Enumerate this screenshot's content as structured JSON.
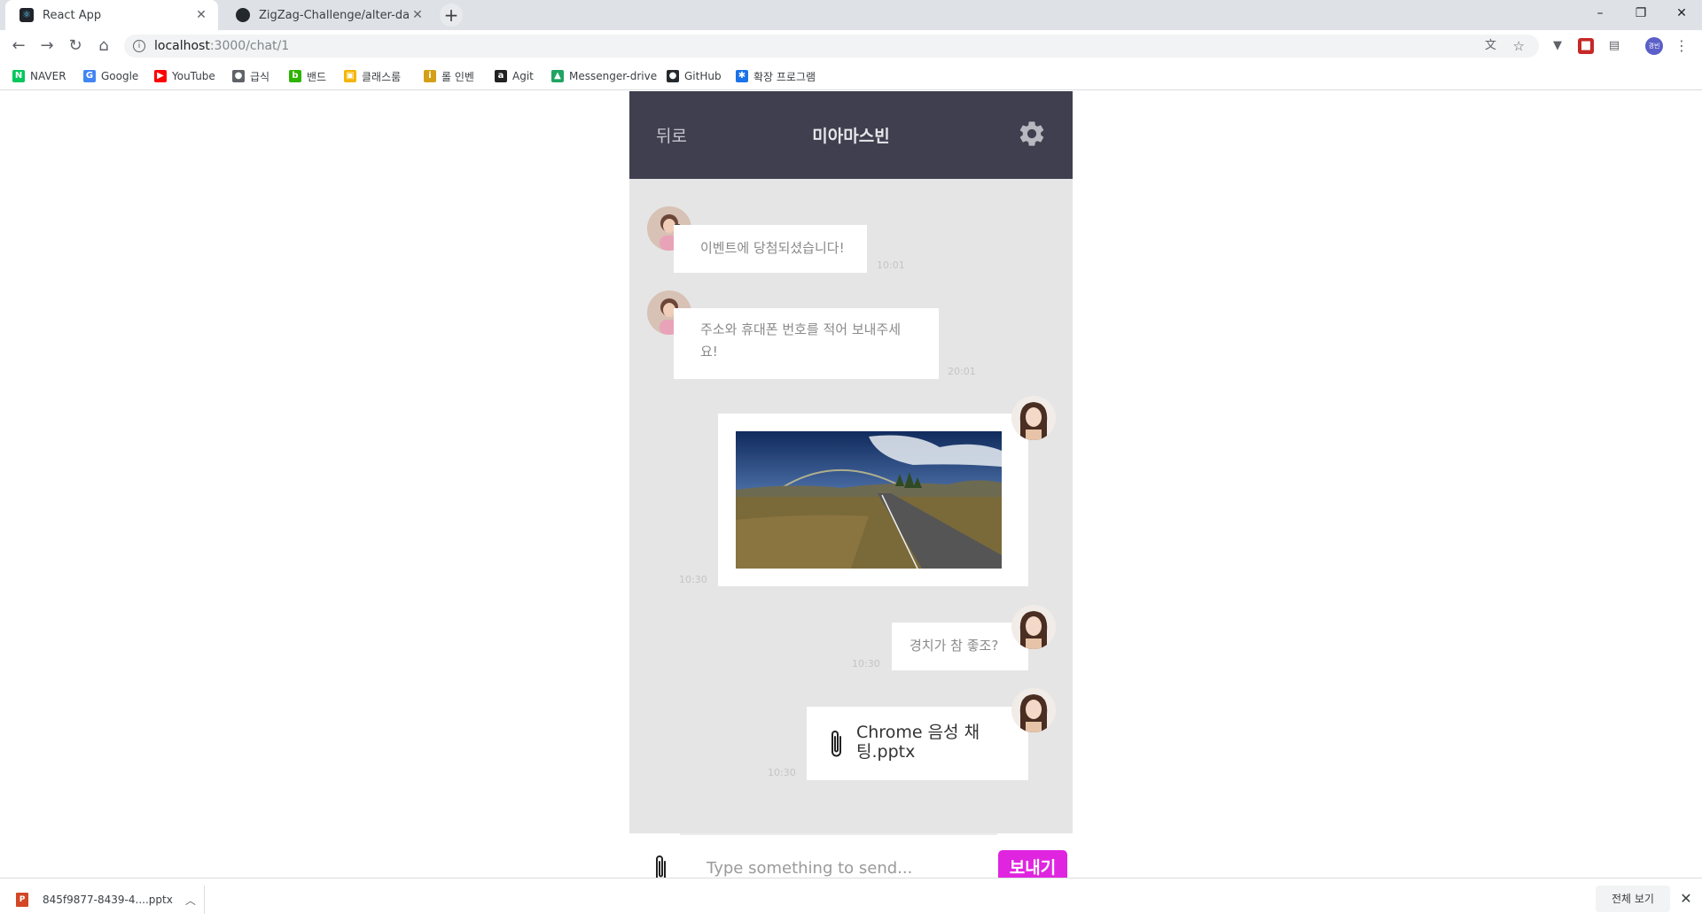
{
  "browser": {
    "tabs": [
      {
        "title": "React App",
        "close": "✕"
      },
      {
        "title": "ZigZag-Challenge/alter-date-for",
        "close": "✕"
      }
    ],
    "new_tab": "+",
    "window_controls": {
      "minimize": "–",
      "restore": "❐",
      "close": "✕"
    },
    "nav": {
      "back": "←",
      "forward": "→",
      "reload": "↻",
      "home": "⌂"
    },
    "url_host": "localhost",
    "url_path": ":3000/chat/1",
    "bookmarks": [
      {
        "label": "NAVER",
        "icon": "N",
        "color": "#03c75a"
      },
      {
        "label": "Google",
        "icon": "G",
        "color": "#4285f4"
      },
      {
        "label": "YouTube",
        "icon": "▶",
        "color": "#ff0000"
      },
      {
        "label": "급식",
        "icon": "●",
        "color": "#5f6368"
      },
      {
        "label": "밴드",
        "icon": "b",
        "color": "#2db400"
      },
      {
        "label": "클래스룸",
        "icon": "▣",
        "color": "#f5b400"
      },
      {
        "label": "롤 인벤",
        "icon": "i",
        "color": "#d4a017"
      },
      {
        "label": "Agit",
        "icon": "a",
        "color": "#222222"
      },
      {
        "label": "Messenger-drive",
        "icon": "▲",
        "color": "#1fa463"
      },
      {
        "label": "GitHub",
        "icon": "●",
        "color": "#24292e"
      },
      {
        "label": "확장 프로그램",
        "icon": "✱",
        "color": "#1a73e8"
      }
    ],
    "profile_initials": "경빈"
  },
  "chat": {
    "header": {
      "back_label": "뒤로",
      "title": "미아마스빈"
    },
    "messages": [
      {
        "sender": "other",
        "type": "text",
        "text": "이벤트에 당첨되셨습니다!",
        "time": "10:01"
      },
      {
        "sender": "other",
        "type": "text",
        "text": "주소와 휴대폰 번호를 적어 보내주세요!",
        "time": "20:01"
      },
      {
        "sender": "me",
        "type": "image",
        "alt": "rainbow over road landscape",
        "time": "10:30"
      },
      {
        "sender": "me",
        "type": "text",
        "text": "경치가 참 좋조?",
        "time": "10:30"
      },
      {
        "sender": "me",
        "type": "file",
        "file_name": "Chrome 음성 채팅.pptx",
        "time": "10:30"
      }
    ],
    "input": {
      "placeholder": "Type something to send...",
      "value": ""
    },
    "send_label": "보내기"
  },
  "downloads": {
    "file": "845f9877-8439-4....pptx",
    "file_icon": "P",
    "show_all": "전체 보기",
    "close": "✕"
  },
  "colors": {
    "header": "#3f3f4f",
    "chat_bg": "#e5e5e5",
    "send_button": "#e025e0"
  }
}
